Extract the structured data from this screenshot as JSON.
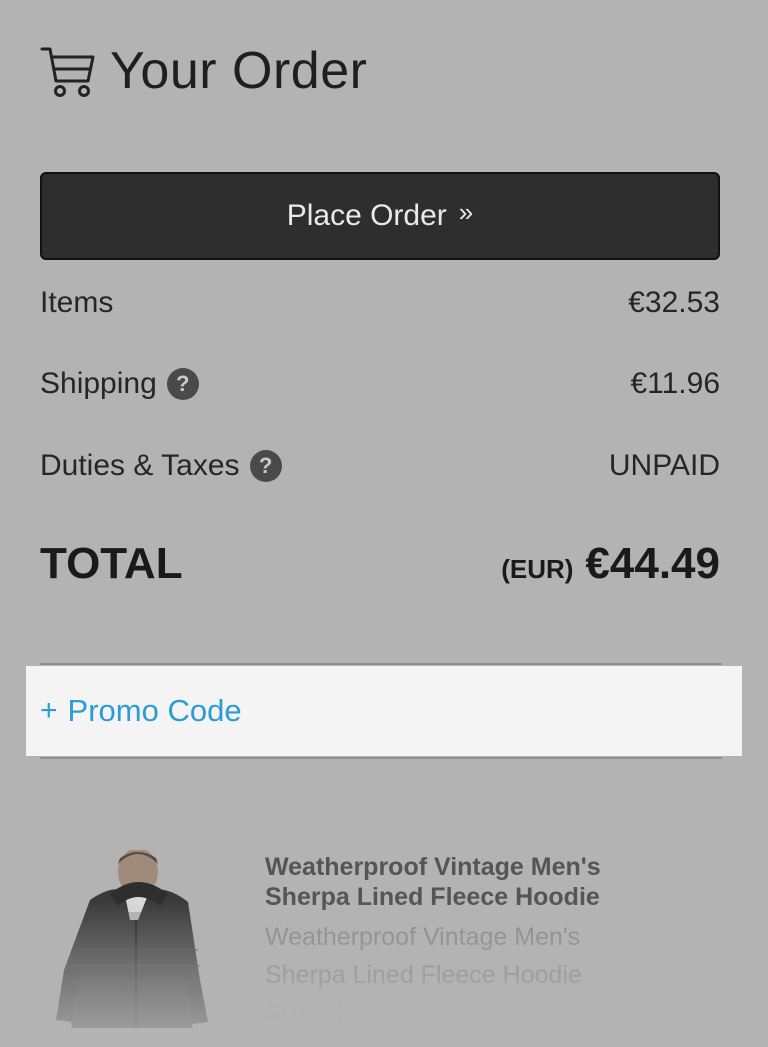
{
  "header": {
    "icon": "cart-icon",
    "title": "Your Order"
  },
  "actions": {
    "place_order_label": "Place Order",
    "place_order_chevron": "»"
  },
  "summary": {
    "items_label": "Items",
    "items_value": "€32.53",
    "shipping_label": "Shipping",
    "shipping_value": "€11.96",
    "duties_label": "Duties & Taxes",
    "duties_value": "UNPAID",
    "help_glyph": "?",
    "total_label": "TOTAL",
    "total_currency": "(EUR)",
    "total_value": "€44.49"
  },
  "promo": {
    "plus": "+",
    "label": "Promo Code"
  },
  "product": {
    "title_line1": "Weatherproof Vintage Men's",
    "title_line2": "Sherpa Lined Fleece Hoodie",
    "subtitle_line1": "Weatherproof Vintage Men's",
    "subtitle_line2": "Sherpa Lined Fleece Hoodie",
    "size": "Size: S"
  },
  "colors": {
    "background": "#b3b3b3",
    "button": "#2e2e2e",
    "accent": "#2d9cd4",
    "promo_bg": "#f4f4f4"
  }
}
